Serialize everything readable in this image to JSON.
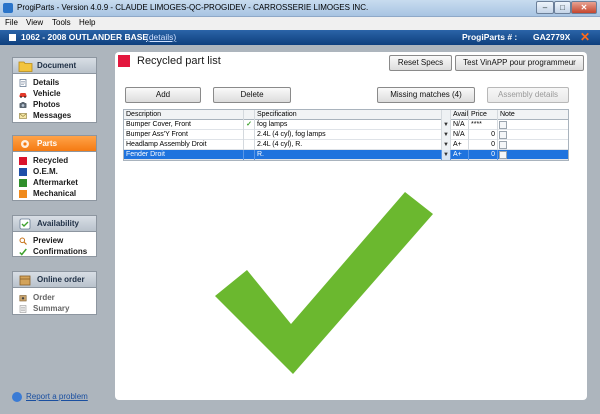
{
  "window": {
    "title": "ProgiParts - Version 4.0.9 - CLAUDE LIMOGES-QC-PROGIDEV - CARROSSERIE LIMOGES INC.",
    "min_label": "–",
    "max_label": "□",
    "close_label": "✕"
  },
  "menu": [
    "File",
    "View",
    "Tools",
    "Help"
  ],
  "vehicle": {
    "title": "1062 - 2008 OUTLANDER BASE",
    "details_link": "(details)",
    "progiparts_label": "ProgiParts # :",
    "progiparts_number": "GA2779X",
    "close_label": "✕"
  },
  "sidebar": {
    "document": {
      "title": "Document",
      "items": [
        "Details",
        "Vehicle",
        "Photos",
        "Messages"
      ]
    },
    "parts": {
      "title": "Parts",
      "items": [
        "Recycled",
        "O.E.M.",
        "Aftermarket",
        "Mechanical"
      ]
    },
    "availability": {
      "title": "Availability",
      "items": [
        "Preview",
        "Confirmations"
      ]
    },
    "online_order": {
      "title": "Online order",
      "items": [
        "Order",
        "Summary"
      ]
    }
  },
  "report_link": "Report a problem",
  "content": {
    "title": "Recycled part list",
    "buttons": {
      "reset_specs": "Reset Specs",
      "test_vinapp": "Test VinAPP pour programmeur",
      "add": "Add",
      "delete": "Delete",
      "missing_matches": "Missing matches (4)",
      "assembly_details": "Assembly details"
    },
    "table": {
      "headers": {
        "description": "Description",
        "specification": "Specification",
        "avail": "Avail",
        "price": "Price",
        "note": "Note"
      },
      "rows": [
        {
          "description": "Bumper Cover, Front",
          "checked": "✓",
          "specification": "fog lamps",
          "avail": "N/A",
          "price": "****"
        },
        {
          "description": "Bumper Ass'Y Front",
          "checked": "",
          "specification": "2.4L (4 cyl), fog lamps",
          "avail": "N/A",
          "price": "0"
        },
        {
          "description": "Headlamp Assembly Droit",
          "checked": "",
          "specification": "2.4L (4 cyl), R.",
          "avail": "A+",
          "price": "0"
        },
        {
          "description": "Fender Droit",
          "checked": "",
          "specification": "R.",
          "avail": "A+",
          "price": "0"
        }
      ]
    }
  },
  "colors": {
    "accent_blue": "#1f73de",
    "parts_orange": "#f57a12",
    "check_green": "#6bb82f",
    "title_red": "#e3173e"
  }
}
